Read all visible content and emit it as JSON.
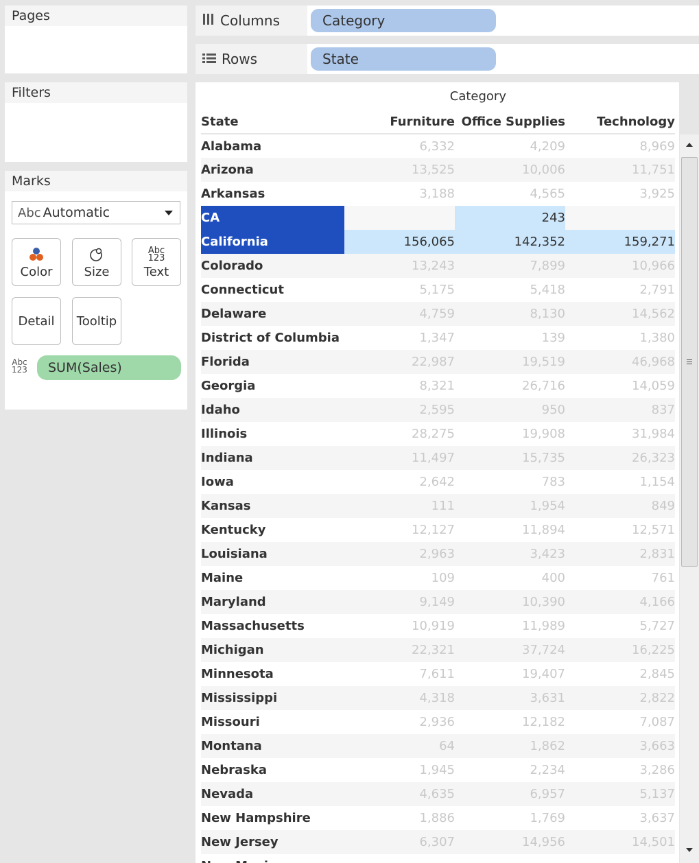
{
  "pages": {
    "title": "Pages"
  },
  "filters": {
    "title": "Filters"
  },
  "marks": {
    "title": "Marks",
    "mark_type_prefix": "Abc",
    "mark_type": "Automatic",
    "buttons": {
      "color": "Color",
      "size": "Size",
      "text": "Text",
      "detail": "Detail",
      "tooltip": "Tooltip"
    },
    "text_icon_top": "Abc",
    "text_icon_bottom": "123",
    "field_icon_top": "Abc",
    "field_icon_bottom": "123",
    "field_pill": "SUM(Sales)"
  },
  "shelves": {
    "columns_label": "Columns",
    "columns_pill": "Category",
    "rows_label": "Rows",
    "rows_pill": "State"
  },
  "view": {
    "category_header": "Category",
    "headers": {
      "state": "State",
      "c1": "Furniture",
      "c2": "Office Supplies",
      "c3": "Technology"
    },
    "rows": [
      {
        "state": "Alabama",
        "furniture": "6,332",
        "office": "4,209",
        "technology": "8,969"
      },
      {
        "state": "Arizona",
        "furniture": "13,525",
        "office": "10,006",
        "technology": "11,751"
      },
      {
        "state": "Arkansas",
        "furniture": "3,188",
        "office": "4,565",
        "technology": "3,925"
      },
      {
        "state": "CA",
        "furniture": "",
        "office": "243",
        "technology": ""
      },
      {
        "state": "California",
        "furniture": "156,065",
        "office": "142,352",
        "technology": "159,271"
      },
      {
        "state": "Colorado",
        "furniture": "13,243",
        "office": "7,899",
        "technology": "10,966"
      },
      {
        "state": "Connecticut",
        "furniture": "5,175",
        "office": "5,418",
        "technology": "2,791"
      },
      {
        "state": "Delaware",
        "furniture": "4,759",
        "office": "8,130",
        "technology": "14,562"
      },
      {
        "state": "District of Columbia",
        "furniture": "1,347",
        "office": "139",
        "technology": "1,380"
      },
      {
        "state": "Florida",
        "furniture": "22,987",
        "office": "19,519",
        "technology": "46,968"
      },
      {
        "state": "Georgia",
        "furniture": "8,321",
        "office": "26,716",
        "technology": "14,059"
      },
      {
        "state": "Idaho",
        "furniture": "2,595",
        "office": "950",
        "technology": "837"
      },
      {
        "state": "Illinois",
        "furniture": "28,275",
        "office": "19,908",
        "technology": "31,984"
      },
      {
        "state": "Indiana",
        "furniture": "11,497",
        "office": "15,735",
        "technology": "26,323"
      },
      {
        "state": "Iowa",
        "furniture": "2,642",
        "office": "783",
        "technology": "1,154"
      },
      {
        "state": "Kansas",
        "furniture": "111",
        "office": "1,954",
        "technology": "849"
      },
      {
        "state": "Kentucky",
        "furniture": "12,127",
        "office": "11,894",
        "technology": "12,571"
      },
      {
        "state": "Louisiana",
        "furniture": "2,963",
        "office": "3,423",
        "technology": "2,831"
      },
      {
        "state": "Maine",
        "furniture": "109",
        "office": "400",
        "technology": "761"
      },
      {
        "state": "Maryland",
        "furniture": "9,149",
        "office": "10,390",
        "technology": "4,166"
      },
      {
        "state": "Massachusetts",
        "furniture": "10,919",
        "office": "11,989",
        "technology": "5,727"
      },
      {
        "state": "Michigan",
        "furniture": "22,321",
        "office": "37,724",
        "technology": "16,225"
      },
      {
        "state": "Minnesota",
        "furniture": "7,611",
        "office": "19,407",
        "technology": "2,845"
      },
      {
        "state": "Mississippi",
        "furniture": "4,318",
        "office": "3,631",
        "technology": "2,822"
      },
      {
        "state": "Missouri",
        "furniture": "2,936",
        "office": "12,182",
        "technology": "7,087"
      },
      {
        "state": "Montana",
        "furniture": "64",
        "office": "1,862",
        "technology": "3,663"
      },
      {
        "state": "Nebraska",
        "furniture": "1,945",
        "office": "2,234",
        "technology": "3,286"
      },
      {
        "state": "Nevada",
        "furniture": "4,635",
        "office": "6,957",
        "technology": "5,137"
      },
      {
        "state": "New Hampshire",
        "furniture": "1,886",
        "office": "1,769",
        "technology": "3,637"
      },
      {
        "state": "New Jersey",
        "furniture": "6,307",
        "office": "14,956",
        "technology": "14,501"
      },
      {
        "state": "New Mexico",
        "furniture": "",
        "office": "",
        "technology": ""
      }
    ]
  },
  "colors": {
    "selection_dark": "#1f4fbf",
    "selection_light": "#cce7fb",
    "column_pill": "#adc7ea",
    "measure_pill": "#9fd8a9"
  }
}
